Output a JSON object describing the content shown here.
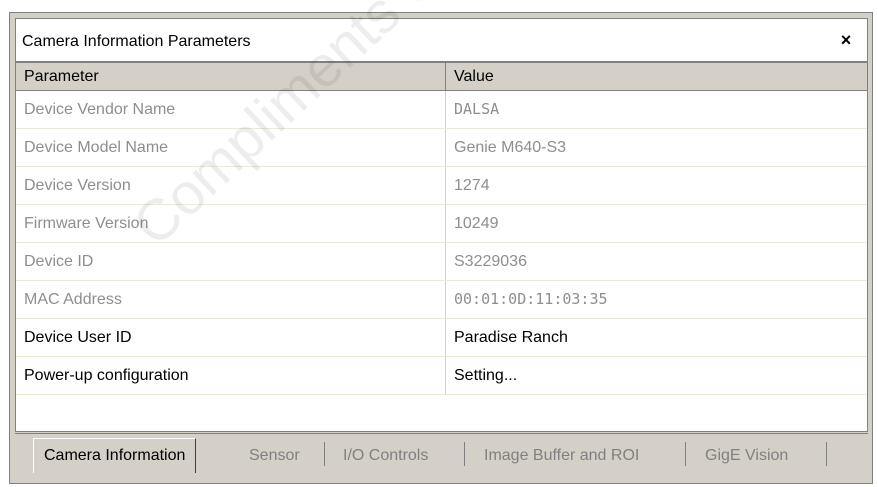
{
  "window": {
    "title": "Camera Information Parameters",
    "close_label": "×"
  },
  "table": {
    "headers": {
      "parameter": "Parameter",
      "value": "Value"
    },
    "rows": [
      {
        "parameter": "Device Vendor Name",
        "value": "DALSA",
        "enabled": false
      },
      {
        "parameter": "Device Model Name",
        "value": "Genie M640-S3",
        "enabled": false
      },
      {
        "parameter": "Device Version",
        "value": "1274",
        "enabled": false
      },
      {
        "parameter": "Firmware Version",
        "value": "10249",
        "enabled": false
      },
      {
        "parameter": "Device ID",
        "value": "S3229036",
        "enabled": false
      },
      {
        "parameter": "MAC Address",
        "value": "00:01:0D:11:03:35",
        "enabled": false
      },
      {
        "parameter": "Device User ID",
        "value": "Paradise Ranch",
        "enabled": true
      },
      {
        "parameter": "Power-up configuration",
        "value": "Setting...",
        "enabled": true
      }
    ]
  },
  "tabs": [
    {
      "label": "Camera Information",
      "active": true
    },
    {
      "label": "Sensor",
      "active": false
    },
    {
      "label": "I/O Controls",
      "active": false
    },
    {
      "label": "Image Buffer and ROI",
      "active": false
    },
    {
      "label": "GigE Vision",
      "active": false
    }
  ],
  "watermark": "Compliments of Pha"
}
